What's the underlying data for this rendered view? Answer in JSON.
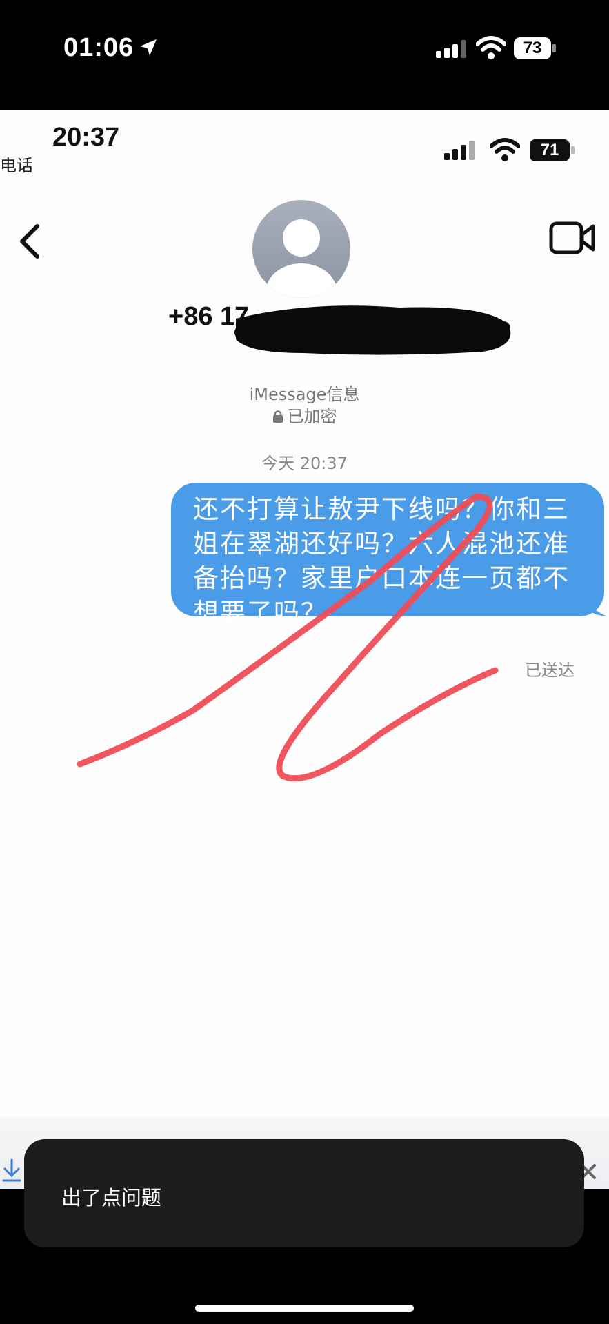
{
  "status_bar": {
    "time": "01:06",
    "battery": "73"
  },
  "screenshot": {
    "status": {
      "time": "20:37",
      "carrier": "电话",
      "battery": "71"
    },
    "contact": {
      "phone_visible": "+86 17"
    },
    "meta": {
      "service": "iMessage信息",
      "encrypted": "已加密",
      "date": "今天 20:37"
    },
    "message": {
      "text": "还不打算让敖尹下线吗？你和三姐在翠湖还好吗？六人混池还准备抬吗？家里户口本连一页都不想要了吗？",
      "status": "已送达",
      "bubble_color": "#4a9be8"
    },
    "annotation_color": "#ef4d57"
  },
  "toast": {
    "text": "出了点问题"
  }
}
